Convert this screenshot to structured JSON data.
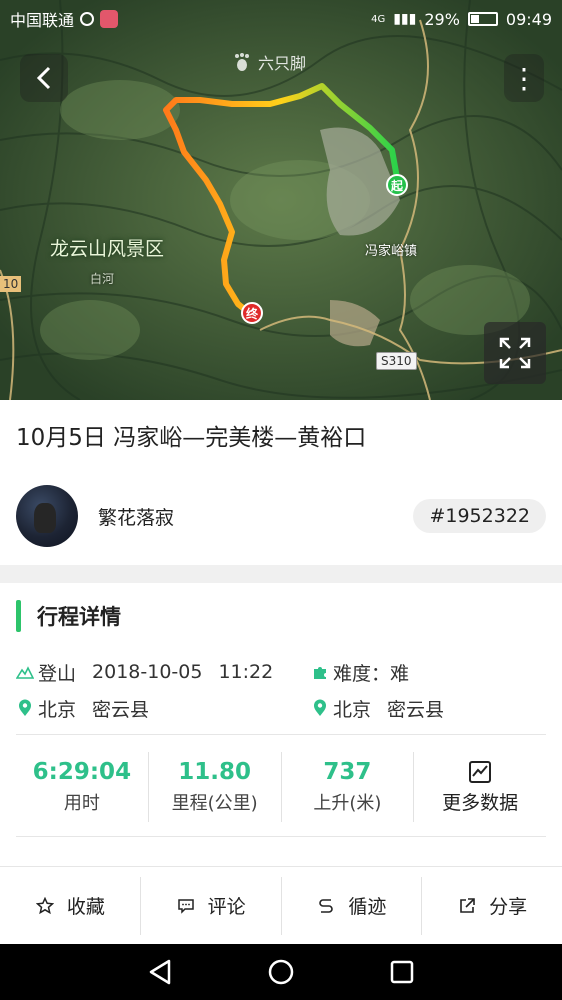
{
  "statusbar": {
    "carrier": "中国联通",
    "battery": "29%",
    "time": "09:49",
    "network": "4G"
  },
  "map": {
    "brand": "六只脚",
    "scenic_label": "龙云山风景区",
    "town_label": "冯家峪镇",
    "river_label": "白河",
    "road_label": "S310",
    "road_left_label": "10",
    "start_marker": "起",
    "end_marker": "终",
    "route_colors": [
      "#ff7a1a",
      "#ffb01a",
      "#ffe01a",
      "#9ee02a",
      "#2ad24a"
    ]
  },
  "trip": {
    "title": "10月5日 冯家峪—完美楼—黄裕口",
    "username": "繁花落寂",
    "track_id": "#1952322"
  },
  "details": {
    "section_title": "行程详情",
    "activity": "登山",
    "date": "2018-10-05",
    "time": "11:22",
    "difficulty_label": "难度：",
    "difficulty_value": "难",
    "start_city": "北京",
    "start_county": "密云县",
    "end_city": "北京",
    "end_county": "密云县"
  },
  "stats": [
    {
      "value": "6:29:04",
      "label": "用时"
    },
    {
      "value": "11.80",
      "label": "里程(公里)"
    },
    {
      "value": "737",
      "label": "上升(米)"
    }
  ],
  "more_data_label": "更多数据",
  "actions": {
    "favorite": "收藏",
    "comment": "评论",
    "follow": "循迹",
    "share": "分享"
  },
  "colors": {
    "accent_green": "#2dc46b",
    "stat_value": "#2ec08a"
  }
}
